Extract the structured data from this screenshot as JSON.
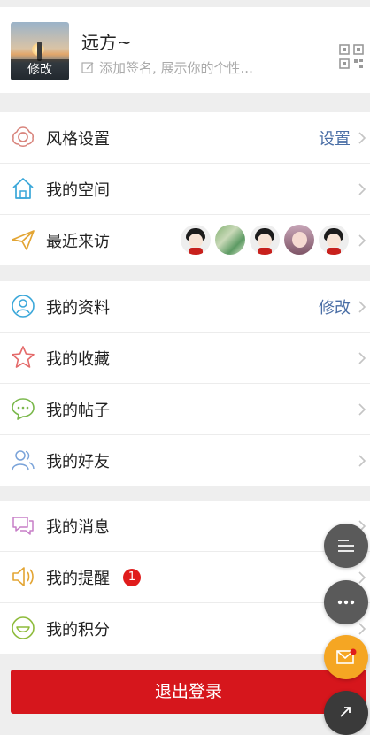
{
  "profile": {
    "nickname": "远方~",
    "signature_placeholder": "添加签名, 展示你的个性...",
    "avatar_edit_label": "修改"
  },
  "group1": [
    {
      "label": "风格设置",
      "value": "设置",
      "icon": "flower-icon",
      "icon_color": "#d8837b"
    },
    {
      "label": "我的空间",
      "value": "",
      "icon": "home-icon",
      "icon_color": "#3aa7d9"
    },
    {
      "label": "最近来访",
      "value": "",
      "icon": "paper-plane-icon",
      "icon_color": "#e3a534"
    }
  ],
  "group2": [
    {
      "label": "我的资料",
      "value": "修改",
      "icon": "user-profile-icon",
      "icon_color": "#3aa7d9"
    },
    {
      "label": "我的收藏",
      "value": "",
      "icon": "star-icon",
      "icon_color": "#e46a6a"
    },
    {
      "label": "我的帖子",
      "value": "",
      "icon": "chat-bubble-icon",
      "icon_color": "#7ab84b"
    },
    {
      "label": "我的好友",
      "value": "",
      "icon": "friends-icon",
      "icon_color": "#7aa3d9"
    }
  ],
  "group3": [
    {
      "label": "我的消息",
      "value": "",
      "icon": "messages-icon",
      "icon_color": "#c77fc7"
    },
    {
      "label": "我的提醒",
      "value": "",
      "badge": "1",
      "icon": "speaker-icon",
      "icon_color": "#e3a534"
    },
    {
      "label": "我的积分",
      "value": "",
      "icon": "points-icon",
      "icon_color": "#8dbb3a"
    }
  ],
  "visitors": [
    "girl",
    "nature",
    "girl",
    "baby",
    "girl"
  ],
  "logout_label": "退出登录",
  "colors": {
    "accent": "#4b6fa6",
    "logout": "#d6161c",
    "badge": "#e01c1c",
    "fab_dark": "#5a5a5a",
    "fab_orange": "#f5a623"
  }
}
